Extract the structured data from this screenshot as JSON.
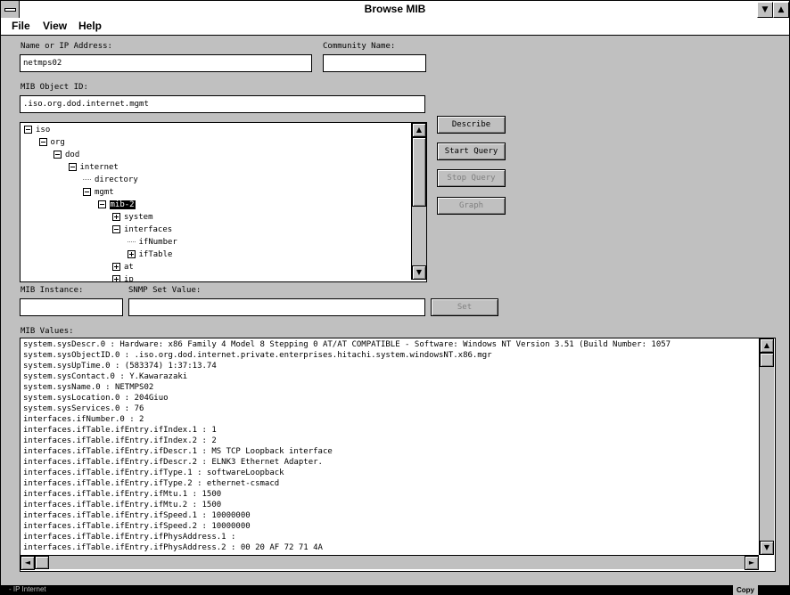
{
  "window": {
    "title": "Browse MIB",
    "minimize_glyph": "▼",
    "maximize_glyph": "▲"
  },
  "menu": [
    {
      "label": "File"
    },
    {
      "label": "View"
    },
    {
      "label": "Help"
    }
  ],
  "fields": {
    "name_label": "Name or IP Address:",
    "name_value": "netmps02",
    "community_label": "Community Name:",
    "community_value": "",
    "oid_label": "MIB Object ID:",
    "oid_value": ".iso.org.dod.internet.mgmt",
    "instance_label": "MIB Instance:",
    "instance_value": "",
    "set_value_label": "SNMP Set Value:",
    "set_value_value": "",
    "values_label": "MIB Values:"
  },
  "buttons": {
    "describe": "Describe",
    "start_query": "Start Query",
    "stop_query": "Stop Query",
    "graph": "Graph",
    "set": "Set"
  },
  "tree": [
    {
      "label": "iso",
      "level": 0,
      "type": "minus"
    },
    {
      "label": "org",
      "level": 1,
      "type": "minus"
    },
    {
      "label": "dod",
      "level": 2,
      "type": "minus"
    },
    {
      "label": "internet",
      "level": 3,
      "type": "minus"
    },
    {
      "label": "directory",
      "level": 4,
      "type": "leaf"
    },
    {
      "label": "mgmt",
      "level": 4,
      "type": "minus"
    },
    {
      "label": "mib-2",
      "level": 5,
      "type": "minus",
      "selected": true
    },
    {
      "label": "system",
      "level": 6,
      "type": "plus"
    },
    {
      "label": "interfaces",
      "level": 6,
      "type": "minus"
    },
    {
      "label": "ifNumber",
      "level": 7,
      "type": "leaf"
    },
    {
      "label": "ifTable",
      "level": 7,
      "type": "plus"
    },
    {
      "label": "at",
      "level": 6,
      "type": "plus"
    },
    {
      "label": "ip",
      "level": 6,
      "type": "plus"
    }
  ],
  "mib_values": [
    "system.sysDescr.0 : Hardware: x86 Family 4 Model 8 Stepping 0 AT/AT COMPATIBLE - Software: Windows NT Version 3.51 (Build Number: 1057",
    "system.sysObjectID.0 : .iso.org.dod.internet.private.enterprises.hitachi.system.windowsNT.x86.mgr",
    "system.sysUpTime.0 : (583374) 1:37:13.74",
    "system.sysContact.0 : Y.Kawarazaki",
    "system.sysName.0 : NETMPS02",
    "system.sysLocation.0 : 204Giuo",
    "system.sysServices.0 : 76",
    "interfaces.ifNumber.0 : 2",
    "interfaces.ifTable.ifEntry.ifIndex.1 : 1",
    "interfaces.ifTable.ifEntry.ifIndex.2 : 2",
    "interfaces.ifTable.ifEntry.ifDescr.1 : MS TCP Loopback interface",
    "interfaces.ifTable.ifEntry.ifDescr.2 : ELNK3 Ethernet Adapter.",
    "interfaces.ifTable.ifEntry.ifType.1 : softwareLoopback",
    "interfaces.ifTable.ifEntry.ifType.2 : ethernet-csmacd",
    "interfaces.ifTable.ifEntry.ifMtu.1 : 1500",
    "interfaces.ifTable.ifEntry.ifMtu.2 : 1500",
    "interfaces.ifTable.ifEntry.ifSpeed.1 : 10000000",
    "interfaces.ifTable.ifEntry.ifSpeed.2 : 10000000",
    "interfaces.ifTable.ifEntry.ifPhysAddress.1 :",
    "interfaces.ifTable.ifEntry.ifPhysAddress.2 : 00 20 AF 72 71 4A"
  ],
  "taskbar": {
    "text": "- IP Internet",
    "right_button": "Copy"
  },
  "scroll": {
    "up": "▲",
    "down": "▼",
    "left": "◄",
    "right": "►"
  }
}
